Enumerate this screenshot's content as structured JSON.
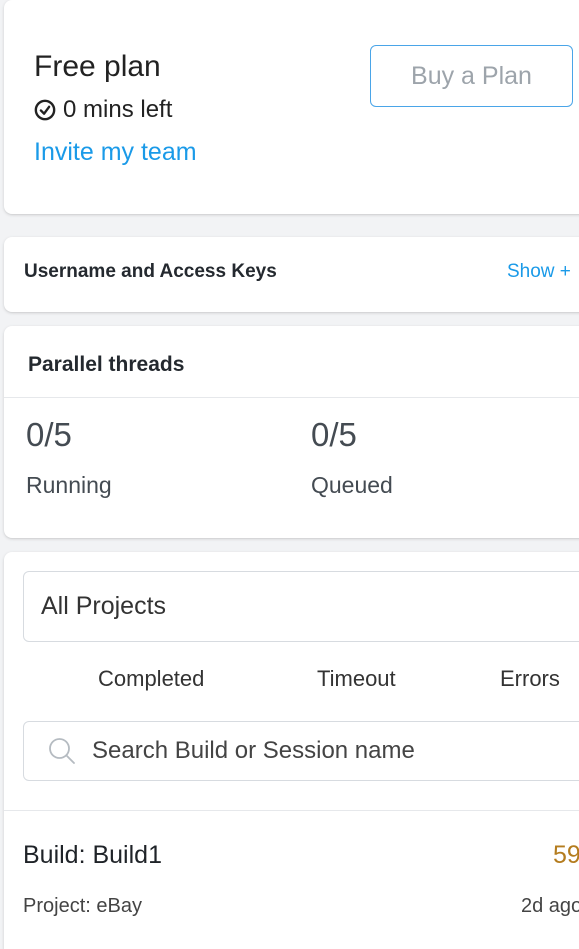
{
  "plan": {
    "title": "Free plan",
    "minutes_left": "0 mins left",
    "invite_link": "Invite my team",
    "buy_button": "Buy a Plan"
  },
  "access_keys": {
    "title": "Username and Access Keys",
    "toggle": "Show +"
  },
  "threads": {
    "title": "Parallel threads",
    "running": {
      "value": "0/5",
      "label": "Running"
    },
    "queued": {
      "value": "0/5",
      "label": "Queued"
    }
  },
  "projects": {
    "selected": "All Projects",
    "tabs": [
      "Completed",
      "Timeout",
      "Errors"
    ],
    "search": {
      "placeholder": "Search Build or Session name",
      "icon": "search-icon"
    }
  },
  "builds": [
    {
      "name": "Build: Build1",
      "count": "59",
      "project": "Project: eBay",
      "time": "2d ago"
    }
  ],
  "colors": {
    "accent": "#1a9ae8",
    "count": "#b47c1e",
    "background": "#f2f3f5"
  }
}
